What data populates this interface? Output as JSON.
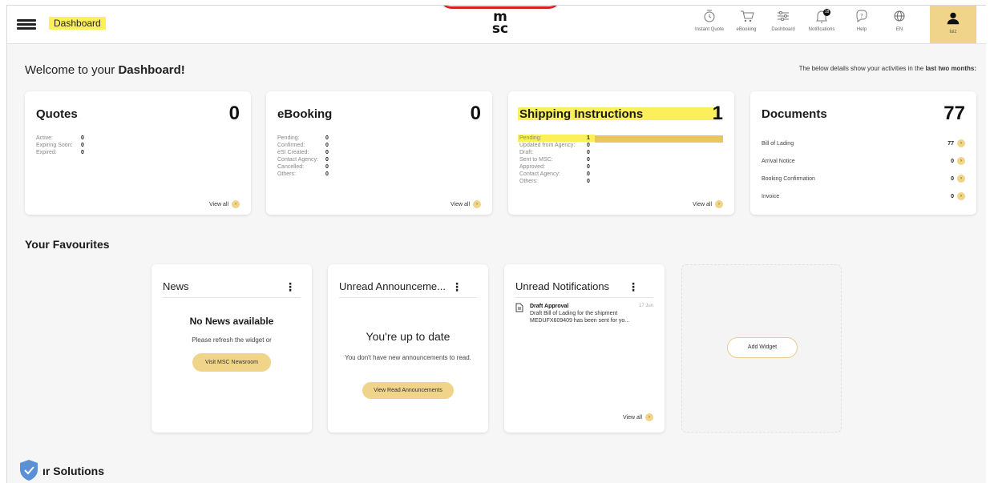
{
  "header": {
    "title": "Dashboard",
    "logo_top": "m",
    "logo_bottom": "sc",
    "nav": [
      {
        "label": "Instant Quote",
        "icon": "instant-quote-icon"
      },
      {
        "label": "eBooking",
        "icon": "cart-icon"
      },
      {
        "label": "Dashboard",
        "icon": "sliders-icon"
      },
      {
        "label": "Notifications",
        "icon": "bell-icon",
        "badge": "18"
      },
      {
        "label": "Help",
        "icon": "help-icon"
      },
      {
        "label": "EN",
        "icon": "globe-icon"
      }
    ],
    "user_label": "luiz"
  },
  "welcome": {
    "prefix": "Welcome to your ",
    "bold": "Dashboard!"
  },
  "activity_note": {
    "prefix": "The below details show your activities in the ",
    "bold": "last two months:"
  },
  "cards": {
    "quotes": {
      "title": "Quotes",
      "count": "0",
      "stats": [
        [
          "Active:",
          "0"
        ],
        [
          "Expiring Soon:",
          "0"
        ],
        [
          "Expired:",
          "0"
        ]
      ],
      "view_all": "View all"
    },
    "ebooking": {
      "title": "eBooking",
      "count": "0",
      "stats": [
        [
          "Pending:",
          "0"
        ],
        [
          "Confirmed:",
          "0"
        ],
        [
          "eSI Created:",
          "0"
        ],
        [
          "Contact Agency:",
          "0"
        ],
        [
          "Cancelled:",
          "0"
        ],
        [
          "Others:",
          "0"
        ]
      ],
      "view_all": "View all"
    },
    "shipping": {
      "title": "Shipping Instructions",
      "count": "1",
      "stats": [
        [
          "Pending:",
          "1"
        ],
        [
          "Updated from Agency:",
          "0"
        ],
        [
          "Draft:",
          "0"
        ],
        [
          "Sent to MSC:",
          "0"
        ],
        [
          "Approved:",
          "0"
        ],
        [
          "Contact Agency:",
          "0"
        ],
        [
          "Others:",
          "0"
        ]
      ],
      "view_all": "View all"
    },
    "documents": {
      "title": "Documents",
      "count": "77",
      "items": [
        [
          "Bill of Lading",
          "77"
        ],
        [
          "Arrival Notice",
          "0"
        ],
        [
          "Booking Confirmation",
          "0"
        ],
        [
          "Invoice",
          "0"
        ]
      ]
    }
  },
  "favourites": {
    "title": "Your Favourites",
    "news": {
      "title": "News",
      "heading": "No News available",
      "text": "Please refresh the widget or",
      "button": "Visit MSC Newsroom"
    },
    "announcements": {
      "title": "Unread Announceme...",
      "heading": "You're up to date",
      "text": "You don't have new announcements to read.",
      "button": "View Read Announcements"
    },
    "notifications": {
      "title": "Unread Notifications",
      "item_title": "Draft Approval",
      "item_date": "17 Jun",
      "item_text": "Draft Bill of Lading for the shipment MEDUFX609409 has been sent for yo...",
      "view_all": "View all"
    },
    "add_widget": "Add Widget"
  },
  "solutions_title": "ır Solutions",
  "colors": {
    "accent": "#efd48a",
    "highlight": "#fbf059",
    "brand_red": "#d62020"
  }
}
